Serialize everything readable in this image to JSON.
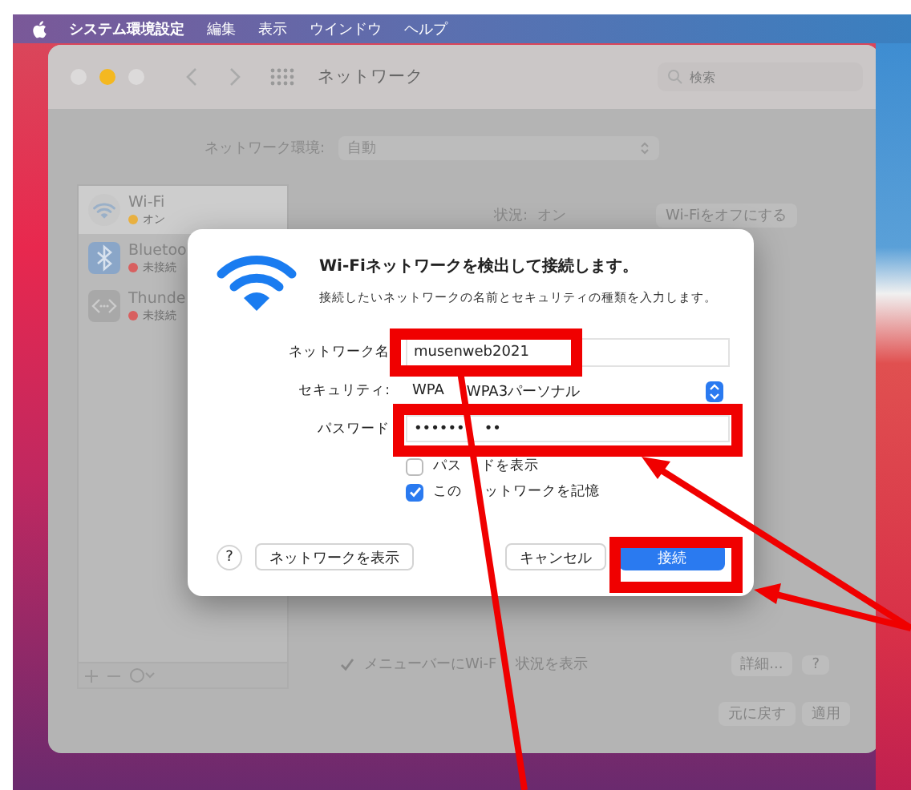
{
  "menu_bar": {
    "app_name": "システム環境設定",
    "menus": [
      "編集",
      "表示",
      "ウインドウ",
      "ヘルプ"
    ]
  },
  "window": {
    "title": "ネットワーク",
    "search": {
      "placeholder": "検索"
    }
  },
  "location": {
    "label": "ネットワーク環境:",
    "value": "自動"
  },
  "sidebar": {
    "items": [
      {
        "name": "Wi-Fi",
        "status": "オン",
        "kind": "wifi",
        "color": "#e8b040",
        "selected": true
      },
      {
        "name": "Bluetoo",
        "status": "未接続",
        "kind": "bluetooth",
        "color": "#d86060",
        "selected": false
      },
      {
        "name": "Thunde",
        "status": "未接続",
        "kind": "thunderbolt",
        "color": "#d86060",
        "selected": false
      }
    ]
  },
  "detail": {
    "status_label": "状況:",
    "status_value": "オン",
    "toggle_button": "Wi-Fiをオフにする",
    "show_in_menu_bar": {
      "label": [
        "メニューバーにWi-F",
        "状況を表示"
      ],
      "checked": true
    },
    "advanced_button": "詳細...",
    "help_button": "?"
  },
  "footer_buttons": [
    "元に戻す",
    "適用"
  ],
  "dialog": {
    "title": "Wi-Fiネットワークを検出して接続します。",
    "message": "接続したいネットワークの名前とセキュリティの種類を入力します。",
    "fields": [
      {
        "kind": "text",
        "label": "ネットワーク名",
        "value": "musenweb2021"
      },
      {
        "kind": "popup",
        "label": "セキュリティ:",
        "value": [
          "WPA",
          "WPA3パーソナル"
        ]
      },
      {
        "kind": "password",
        "label": "パスワード",
        "value": [
          "••••••",
          "••"
        ]
      }
    ],
    "checkboxes": [
      {
        "label": [
          "パス",
          "ドを表示"
        ],
        "checked": false
      },
      {
        "label": [
          "この",
          "ットワークを記憶"
        ],
        "checked": true
      }
    ],
    "help_button": "?",
    "show_networks_button": "ネットワークを表示",
    "cancel_button": "キャンセル",
    "join_button": "接続"
  }
}
